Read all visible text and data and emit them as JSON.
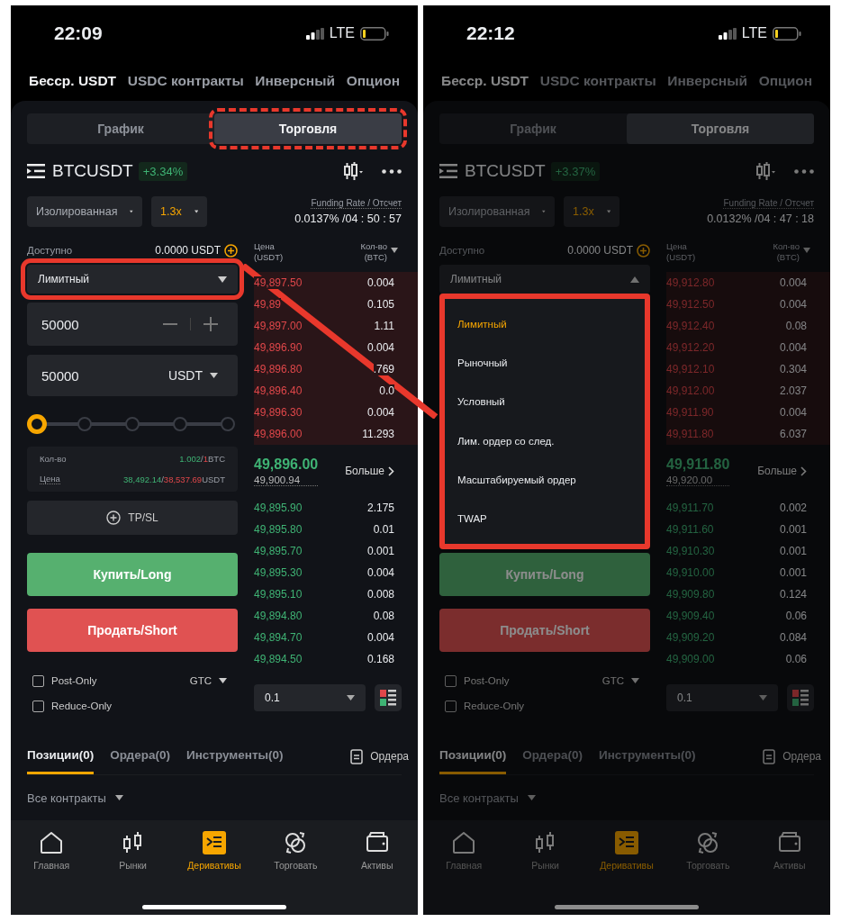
{
  "screens": [
    {
      "dimmed": false,
      "time": "22:09",
      "network": "LTE",
      "top_tabs": [
        {
          "label": "Бесср. USDT",
          "selected": true
        },
        {
          "label": "USDC контракты",
          "selected": false
        },
        {
          "label": "Инверсный",
          "selected": false
        },
        {
          "label": "Опцион",
          "selected": false
        }
      ],
      "view_tabs": [
        {
          "label": "График",
          "selected": false,
          "highlighted": false
        },
        {
          "label": "Торговля",
          "selected": true,
          "highlighted": true
        }
      ],
      "symbol": "BTCUSDT",
      "change": "+3.34%",
      "margin_mode": "Изолированная",
      "leverage": "1.3x",
      "funding_label": "Funding Rate / Отсчет",
      "funding_value": "0.0137% /04 : 50 : 57",
      "available_label": "Доступно",
      "available_value": "0.0000 USDT",
      "order_type": {
        "value": "Лимитный",
        "expanded": false,
        "highlighted": true
      },
      "form": {
        "price": "50000",
        "amount": "50000",
        "unit": "USDT",
        "slider": {
          "level": 0
        },
        "qty_label": "Кол-во",
        "qty_buy": "1.002",
        "sep": "/",
        "qty_sell": "1",
        "qty_unit": "BTC",
        "price_label": "Цена",
        "price_buy": "38,492.14",
        "price_sell": "38,537.69",
        "price_unit": "USDT",
        "tpsl": "TP/SL"
      },
      "buy": "Купить/Long",
      "sell": "Продать/Short",
      "options": [
        {
          "label": "Post-Only",
          "checked": false
        },
        {
          "label": "Reduce-Only",
          "checked": false
        }
      ],
      "tif": "GTC",
      "book": {
        "price_header": "Цена (USDT)",
        "qty_header": "Кол-во (BTC)",
        "asks": [
          {
            "price": "49,897.50",
            "qty": "0.004"
          },
          {
            "price": "49,89",
            "qty": "0.105"
          },
          {
            "price": "49,897.00",
            "qty": "1.11"
          },
          {
            "price": "49,896.90",
            "qty": "0.004"
          },
          {
            "price": "49,896.80",
            "qty": ".769"
          },
          {
            "price": "49,896.40",
            "qty": "0.0"
          },
          {
            "price": "49,896.30",
            "qty": "0.004"
          },
          {
            "price": "49,896.00",
            "qty": "11.293"
          }
        ],
        "last_price": "49,896.00",
        "mark_price": "49,900.94",
        "more": "Больше",
        "bids": [
          {
            "price": "49,895.90",
            "qty": "2.175"
          },
          {
            "price": "49,895.80",
            "qty": "0.01"
          },
          {
            "price": "49,895.70",
            "qty": "0.001"
          },
          {
            "price": "49,895.30",
            "qty": "0.004"
          },
          {
            "price": "49,895.10",
            "qty": "0.008"
          },
          {
            "price": "49,894.80",
            "qty": "0.08"
          },
          {
            "price": "49,894.70",
            "qty": "0.004"
          },
          {
            "price": "49,894.50",
            "qty": "0.168"
          }
        ],
        "depth": "0.1"
      },
      "bottom_tabs": [
        {
          "label": "Позиции(0)",
          "selected": true
        },
        {
          "label": "Ордера(0)",
          "selected": false
        },
        {
          "label": "Инструменты(0)",
          "selected": false
        }
      ],
      "orders_link": "Ордера",
      "filter": "Все контракты",
      "nav": [
        {
          "label": "Главная",
          "selected": false
        },
        {
          "label": "Рынки",
          "selected": false
        },
        {
          "label": "Деривативы",
          "selected": true
        },
        {
          "label": "Торговать",
          "selected": false
        },
        {
          "label": "Активы",
          "selected": false
        }
      ]
    },
    {
      "dimmed": true,
      "time": "22:12",
      "network": "LTE",
      "top_tabs": [
        {
          "label": "Бесср. USDT",
          "selected": true
        },
        {
          "label": "USDC контракты",
          "selected": false
        },
        {
          "label": "Инверсный",
          "selected": false
        },
        {
          "label": "Опцион",
          "selected": false
        }
      ],
      "view_tabs": [
        {
          "label": "График",
          "selected": false,
          "highlighted": false
        },
        {
          "label": "Торговля",
          "selected": true,
          "highlighted": false
        }
      ],
      "symbol": "BTCUSDT",
      "change": "+3.37%",
      "margin_mode": "Изолированная",
      "leverage": "1.3x",
      "funding_label": "Funding Rate / Отсчет",
      "funding_value": "0.0132% /04 : 47 : 18",
      "available_label": "Доступно",
      "available_value": "0.0000 USDT",
      "order_type": {
        "value": "Лимитный",
        "expanded": true,
        "highlighted": false
      },
      "menu": {
        "highlighted": true,
        "items": [
          {
            "label": "Лимитный",
            "selected": true
          },
          {
            "label": "Рыночный",
            "selected": false
          },
          {
            "label": "Условный",
            "selected": false
          },
          {
            "label": "Лим. ордер со след.",
            "selected": false
          },
          {
            "label": "Масштабируемый ордер",
            "selected": false
          },
          {
            "label": "TWAP",
            "selected": false
          }
        ]
      },
      "buy": "Купить/Long",
      "sell": "Продать/Short",
      "options": [
        {
          "label": "Post-Only",
          "checked": false
        },
        {
          "label": "Reduce-Only",
          "checked": false
        }
      ],
      "tif": "GTC",
      "book": {
        "price_header": "Цена (USDT)",
        "qty_header": "Кол-во (BTC)",
        "asks": [
          {
            "price": "49,912.80",
            "qty": "0.004"
          },
          {
            "price": "49,912.50",
            "qty": "0.004"
          },
          {
            "price": "49,912.40",
            "qty": "0.08"
          },
          {
            "price": "49,912.20",
            "qty": "0.004"
          },
          {
            "price": "49,912.10",
            "qty": "0.304"
          },
          {
            "price": "49,912.00",
            "qty": "2.037"
          },
          {
            "price": "49,911.90",
            "qty": "0.004"
          },
          {
            "price": "49,911.80",
            "qty": "6.037"
          }
        ],
        "last_price": "49,911.80",
        "mark_price": "49,920.00",
        "more": "Больше",
        "bids": [
          {
            "price": "49,911.70",
            "qty": "0.002"
          },
          {
            "price": "49,911.60",
            "qty": "0.001"
          },
          {
            "price": "49,910.30",
            "qty": "0.001"
          },
          {
            "price": "49,910.00",
            "qty": "0.001"
          },
          {
            "price": "49,909.80",
            "qty": "0.124"
          },
          {
            "price": "49,909.40",
            "qty": "0.06"
          },
          {
            "price": "49,909.20",
            "qty": "0.084"
          },
          {
            "price": "49,909.00",
            "qty": "0.06"
          }
        ],
        "depth": "0.1"
      },
      "bottom_tabs": [
        {
          "label": "Позиции(0)",
          "selected": true
        },
        {
          "label": "Ордера(0)",
          "selected": false
        },
        {
          "label": "Инструменты(0)",
          "selected": false
        }
      ],
      "orders_link": "Ордера",
      "filter": "Все контракты",
      "nav": [
        {
          "label": "Главная",
          "selected": false
        },
        {
          "label": "Рынки",
          "selected": false
        },
        {
          "label": "Деривативы",
          "selected": true
        },
        {
          "label": "Торговать",
          "selected": false
        },
        {
          "label": "Активы",
          "selected": false
        }
      ]
    }
  ]
}
